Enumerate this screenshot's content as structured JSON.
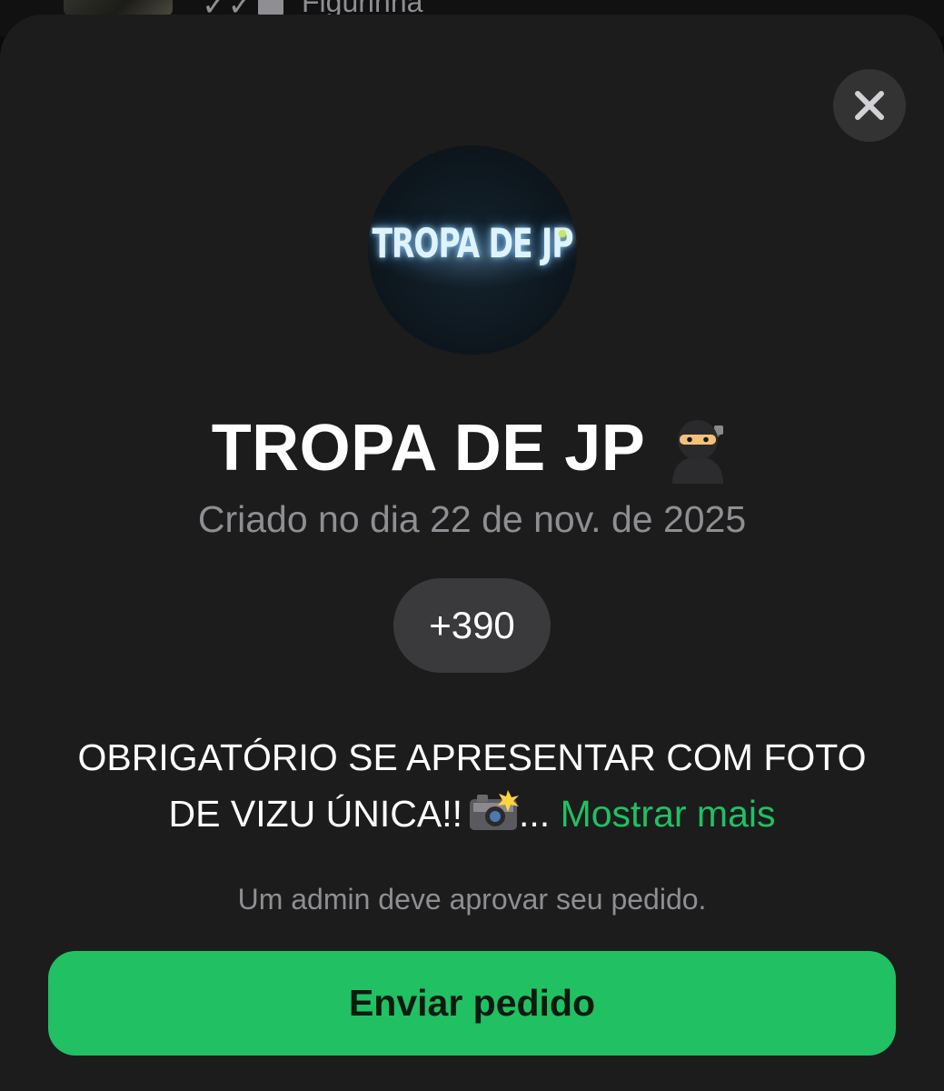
{
  "background_chat": {
    "message_preview": "Figurinha"
  },
  "dialog": {
    "avatar_text": "TROPA DE JP",
    "group_name": "TROPA DE JP",
    "created_date": "Criado no dia 22 de nov. de 2025",
    "members_count": "+390",
    "description_line1": "OBRIGATÓRIO SE APRESENTAR COM FOTO",
    "description_line2": "DE VIZU ÚNICA!!",
    "description_ellipsis": "...",
    "show_more": "Mostrar mais",
    "approval_note": "Um admin deve aprovar seu pedido.",
    "send_button": "Enviar pedido"
  },
  "icons": {
    "close": "close-icon",
    "title_emoji": "ninja-icon",
    "description_emoji": "camera-flash-icon",
    "background_sticker": "sticker-icon",
    "background_checkmarks": "double-check-icon"
  },
  "colors": {
    "sheet_background": "#1c1c1c",
    "accent_green": "#21c063",
    "secondary_text": "#8e8e93",
    "pill_background": "#3a3a3c"
  }
}
